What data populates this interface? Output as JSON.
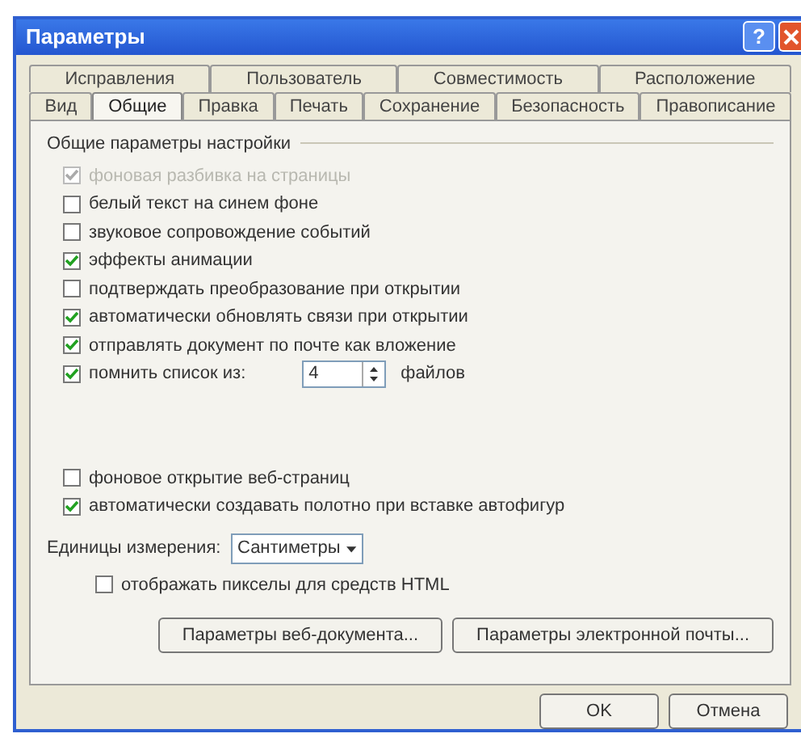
{
  "window": {
    "title": "Параметры",
    "help_button": "?"
  },
  "tab_rows": [
    {
      "tabs": [
        {
          "label": "Исправления",
          "selected": false
        },
        {
          "label": "Пользователь",
          "selected": false
        },
        {
          "label": "Совместимость",
          "selected": false
        },
        {
          "label": "Расположение",
          "selected": false
        }
      ]
    },
    {
      "tabs": [
        {
          "label": "Вид",
          "selected": false
        },
        {
          "label": "Общие",
          "selected": true
        },
        {
          "label": "Правка",
          "selected": false
        },
        {
          "label": "Печать",
          "selected": false
        },
        {
          "label": "Сохранение",
          "selected": false
        },
        {
          "label": "Безопасность",
          "selected": false
        },
        {
          "label": "Правописание",
          "selected": false
        }
      ]
    }
  ],
  "group": {
    "title": "Общие параметры настройки",
    "options_top": [
      {
        "kind": "checkbox",
        "label": "фоновая разбивка на страницы",
        "checked": true,
        "disabled": true
      },
      {
        "kind": "checkbox",
        "label": "белый текст на синем фоне",
        "checked": false,
        "disabled": false
      },
      {
        "kind": "checkbox",
        "label": "звуковое сопровождение событий",
        "checked": false,
        "disabled": false
      },
      {
        "kind": "checkbox",
        "label": "эффекты анимации",
        "checked": true,
        "disabled": false
      },
      {
        "kind": "checkbox",
        "label": "подтверждать преобразование при открытии",
        "checked": false,
        "disabled": false
      },
      {
        "kind": "checkbox",
        "label": "автоматически обновлять связи при открытии",
        "checked": true,
        "disabled": false
      },
      {
        "kind": "checkbox",
        "label": "отправлять документ по почте как вложение",
        "checked": true,
        "disabled": false
      },
      {
        "kind": "spinner",
        "label": "помнить список из:",
        "checked": true,
        "disabled": false,
        "value": "4",
        "suffix": "файлов"
      }
    ],
    "options_bottom": [
      {
        "kind": "checkbox",
        "label": "фоновое открытие веб-страниц",
        "checked": false,
        "disabled": false
      },
      {
        "kind": "checkbox",
        "label": "автоматически создавать полотно при вставке автофигур",
        "checked": true,
        "disabled": false
      }
    ],
    "units": {
      "label": "Единицы измерения:",
      "value": "Сантиметры"
    },
    "html_option": {
      "label": "отображать пикселы для средств HTML",
      "checked": false
    },
    "buttons": [
      "Параметры веб-документа...",
      "Параметры электронной почты..."
    ]
  },
  "dialog_buttons": [
    "OK",
    "Отмена"
  ]
}
